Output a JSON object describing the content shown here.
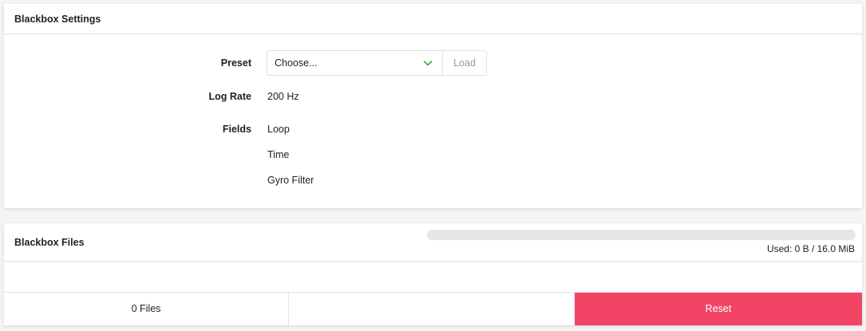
{
  "settings": {
    "title": "Blackbox Settings",
    "preset": {
      "label": "Preset",
      "selected": "Choose...",
      "load_label": "Load"
    },
    "log_rate": {
      "label": "Log Rate",
      "value": "200 Hz"
    },
    "fields": {
      "label": "Fields",
      "items": [
        "Loop",
        "Time",
        "Gyro Filter"
      ]
    }
  },
  "files": {
    "title": "Blackbox Files",
    "usage": {
      "text": "Used: 0 B / 16.0 MiB",
      "fraction": 0
    },
    "count_label": "0 Files",
    "reset_label": "Reset"
  },
  "colors": {
    "accent": "#f24566",
    "chevron": "#4aa84a"
  }
}
